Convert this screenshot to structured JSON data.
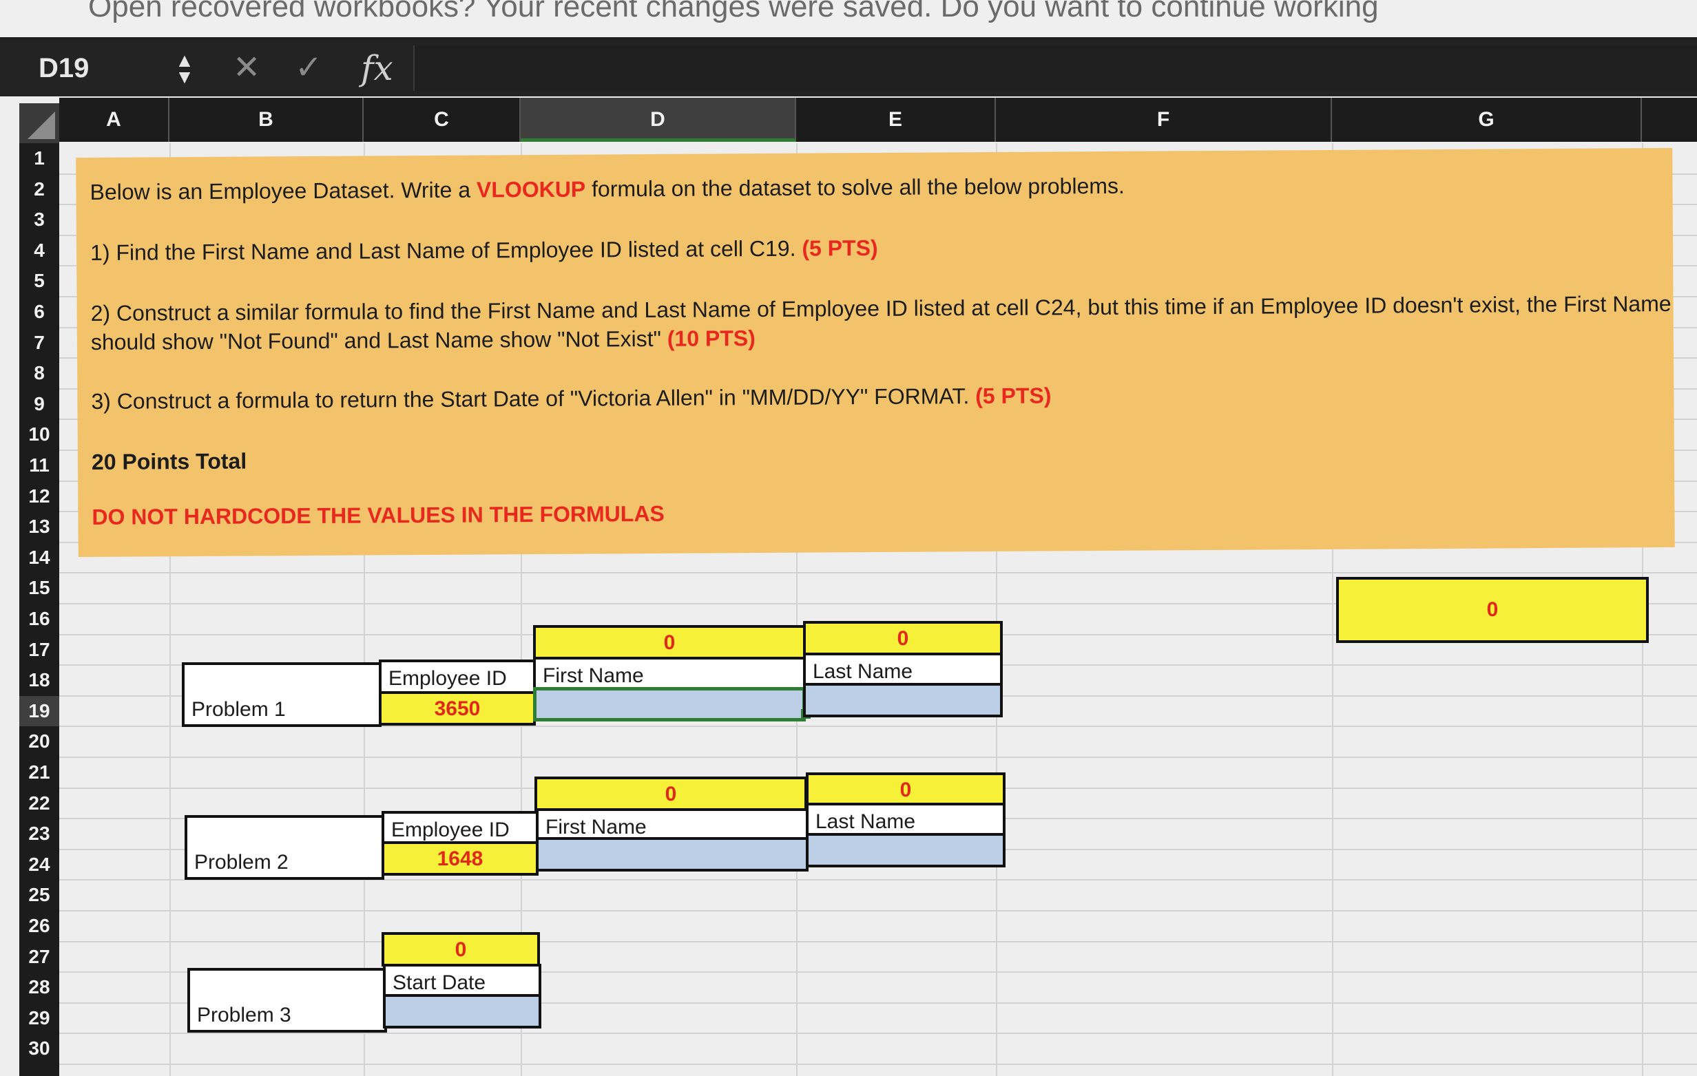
{
  "notification": {
    "text": "Open recovered workbooks?  Your recent changes were saved. Do you want to continue working"
  },
  "formula_bar": {
    "name_box": "D19",
    "fx_label": "fx",
    "formula": ""
  },
  "columns": [
    "A",
    "B",
    "C",
    "D",
    "E",
    "F",
    "G"
  ],
  "selected_column": "D",
  "rows": [
    "1",
    "2",
    "3",
    "4",
    "5",
    "6",
    "7",
    "8",
    "9",
    "10",
    "11",
    "12",
    "13",
    "14",
    "15",
    "16",
    "17",
    "18",
    "19",
    "20",
    "21",
    "22",
    "23",
    "24",
    "25",
    "26",
    "27",
    "28",
    "29",
    "30"
  ],
  "selected_row": "19",
  "instructions": {
    "intro_pre": "Below is an Employee Dataset. Write a ",
    "intro_keyword": "VLOOKUP",
    "intro_post": " formula on the dataset to solve all the below problems.",
    "q1_text": "1) Find the First Name and Last Name of Employee ID listed at cell C19. ",
    "q1_pts": "(5 PTS)",
    "q2_text_line1": "2) Construct a similar formula to find the First Name and Last Name of Employee ID listed at cell C24, but this time if an Employee ID doesn't exist, the First Name",
    "q2_text_line2": "should show \"Not Found\" and Last Name show \"Not Exist\" ",
    "q2_pts": "(10 PTS)",
    "q3_text": "3) Construct a formula to return the Start Date of \"Victoria Allen\" in \"MM/DD/YY\" FORMAT. ",
    "q3_pts": "(5 PTS)",
    "total": "20 Points Total",
    "warning": "DO NOT HARDCODE THE VALUES IN THE FORMULAS"
  },
  "g16_value": "0",
  "problem1": {
    "label": "Problem 1",
    "id_header": "Employee ID",
    "id_value": "3650",
    "first_header": "First Name",
    "last_header": "Last Name",
    "first_top": "0",
    "last_top": "0"
  },
  "problem2": {
    "label": "Problem 2",
    "id_header": "Employee ID",
    "id_value": "1648",
    "first_header": "First Name",
    "last_header": "Last Name",
    "first_top": "0",
    "last_top": "0"
  },
  "problem3": {
    "label": "Problem 3",
    "date_header": "Start Date",
    "date_top": "0"
  },
  "colors": {
    "instruction_fill": "#f2c36b",
    "highlight_yellow": "#f7f039",
    "input_blue": "#bccde6",
    "accent_red": "#e8281e",
    "selection_green": "#2e7d32"
  }
}
